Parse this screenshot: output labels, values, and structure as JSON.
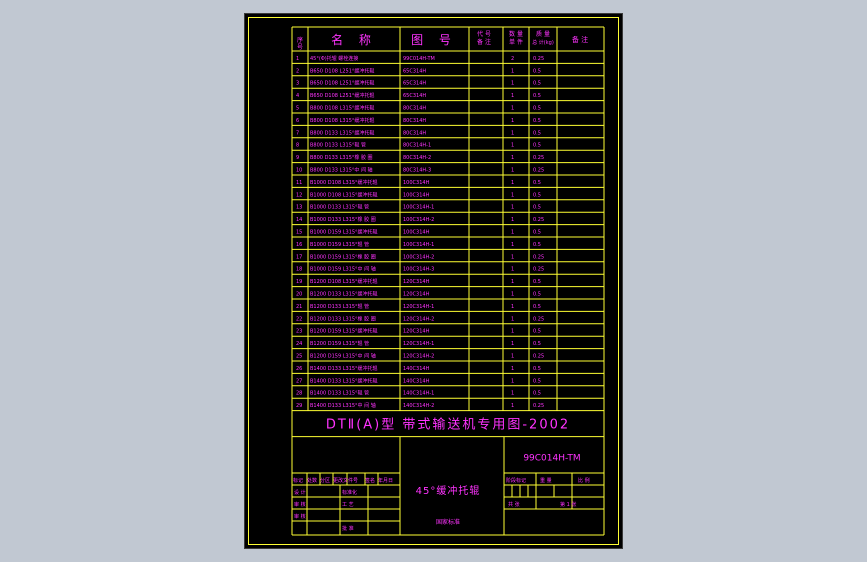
{
  "colors": {
    "background": "#c1c8d2",
    "sheet": "#000000",
    "line": "#ffff33",
    "text": "#ff33ff"
  },
  "header": {
    "seq": "序号",
    "name": "名 称",
    "drawing_no": "图 号",
    "material": "件数",
    "qty": "数量",
    "weight": "质量",
    "remark": "备 注"
  },
  "rows": [
    {
      "seq": "1",
      "name": "45°(Φ)托辊 螺栓连接",
      "dwg": "99C014H-TM",
      "qty": "",
      "mass": "2",
      "w": "0.25"
    },
    {
      "seq": "2",
      "name": "B650 D108 L251°缓冲托辊",
      "dwg": "65C314H",
      "qty": "",
      "mass": "1",
      "w": "0.5"
    },
    {
      "seq": "3",
      "name": "B650 D108 L251°缓冲托辊",
      "dwg": "65C314H",
      "qty": "",
      "mass": "1",
      "w": "0.5"
    },
    {
      "seq": "4",
      "name": "B650 D108 L251°缓冲托辊",
      "dwg": "65C314H",
      "qty": "",
      "mass": "1",
      "w": "0.5"
    },
    {
      "seq": "5",
      "name": "B800 D108 L315°缓冲托辊",
      "dwg": "80C314H",
      "qty": "",
      "mass": "1",
      "w": "0.5"
    },
    {
      "seq": "6",
      "name": "B800 D108 L315°缓冲托辊",
      "dwg": "80C314H",
      "qty": "",
      "mass": "1",
      "w": "0.5"
    },
    {
      "seq": "7",
      "name": "B800 D133 L315°缓冲托辊",
      "dwg": "80C314H",
      "qty": "",
      "mass": "1",
      "w": "0.5"
    },
    {
      "seq": "8",
      "name": "B800 D133 L315°辊 管",
      "dwg": "80C314H-1",
      "qty": "",
      "mass": "1",
      "w": "0.5"
    },
    {
      "seq": "9",
      "name": "B800 D133 L315°橡 胶 圈",
      "dwg": "80C314H-2",
      "qty": "",
      "mass": "1",
      "w": "0.25"
    },
    {
      "seq": "10",
      "name": "B800 D133 L315°中 间 轴",
      "dwg": "80C314H-3",
      "qty": "",
      "mass": "1",
      "w": "0.25"
    },
    {
      "seq": "11",
      "name": "B1000 D108 L315°缓冲托辊",
      "dwg": "100C314H",
      "qty": "",
      "mass": "1",
      "w": "0.5"
    },
    {
      "seq": "12",
      "name": "B1000 D108 L315°缓冲托辊",
      "dwg": "100C314H",
      "qty": "",
      "mass": "1",
      "w": "0.5"
    },
    {
      "seq": "13",
      "name": "B1000 D133 L315°辊 管",
      "dwg": "100C314H-1",
      "qty": "",
      "mass": "1",
      "w": "0.5"
    },
    {
      "seq": "14",
      "name": "B1000 D133 L315°橡 胶 圈",
      "dwg": "100C314H-2",
      "qty": "",
      "mass": "1",
      "w": "0.25"
    },
    {
      "seq": "15",
      "name": "B1000 D159 L315°缓冲托辊",
      "dwg": "100C314H",
      "qty": "",
      "mass": "1",
      "w": "0.5"
    },
    {
      "seq": "16",
      "name": "B1000 D159 L315°辊 管",
      "dwg": "100C314H-1",
      "qty": "",
      "mass": "1",
      "w": "0.5"
    },
    {
      "seq": "17",
      "name": "B1000 D159 L315°橡 胶 圈",
      "dwg": "100C314H-2",
      "qty": "",
      "mass": "1",
      "w": "0.25"
    },
    {
      "seq": "18",
      "name": "B1000 D159 L315°中 间 轴",
      "dwg": "100C314H-3",
      "qty": "",
      "mass": "1",
      "w": "0.25"
    },
    {
      "seq": "19",
      "name": "B1200 D108 L315°缓冲托辊",
      "dwg": "120C314H",
      "qty": "",
      "mass": "1",
      "w": "0.5"
    },
    {
      "seq": "20",
      "name": "B1200 D133 L315°缓冲托辊",
      "dwg": "120C314H",
      "qty": "",
      "mass": "1",
      "w": "0.5"
    },
    {
      "seq": "21",
      "name": "B1200 D133 L315°辊 管",
      "dwg": "120C314H-1",
      "qty": "",
      "mass": "1",
      "w": "0.5"
    },
    {
      "seq": "22",
      "name": "B1200 D133 L315°橡 胶 圈",
      "dwg": "120C314H-2",
      "qty": "",
      "mass": "1",
      "w": "0.25"
    },
    {
      "seq": "23",
      "name": "B1200 D159 L315°缓冲托辊",
      "dwg": "120C314H",
      "qty": "",
      "mass": "1",
      "w": "0.5"
    },
    {
      "seq": "24",
      "name": "B1200 D159 L315°辊 管",
      "dwg": "120C314H-1",
      "qty": "",
      "mass": "1",
      "w": "0.5"
    },
    {
      "seq": "25",
      "name": "B1200 D159 L315°中 间 轴",
      "dwg": "120C314H-2",
      "qty": "",
      "mass": "1",
      "w": "0.25"
    },
    {
      "seq": "26",
      "name": "B1400 D133 L315°缓冲托辊",
      "dwg": "140C314H",
      "qty": "",
      "mass": "1",
      "w": "0.5"
    },
    {
      "seq": "27",
      "name": "B1400 D133 L315°缓冲托辊",
      "dwg": "140C314H",
      "qty": "",
      "mass": "1",
      "w": "0.5"
    },
    {
      "seq": "28",
      "name": "B1400 D133 L315°辊 管",
      "dwg": "140C314H-1",
      "qty": "",
      "mass": "1",
      "w": "0.5"
    },
    {
      "seq": "29",
      "name": "B1400 D133 L315°中 间 轴",
      "dwg": "140C314H-2",
      "qty": "",
      "mass": "1",
      "w": "0.25"
    }
  ],
  "title_block": {
    "main_title": "DTⅡ(A)型 带式输送机专用图-2002",
    "drawing_number": "99C014H-TM",
    "part_name": "45°缓冲托辊",
    "stage_label": "阶段标记",
    "weight_label": "重 量",
    "scale_label": "比 例",
    "sheet_total": "共 张",
    "sheet_no": "第 1 张",
    "rev_header": [
      "标记",
      "处数",
      "分区",
      "更改文件号",
      "签名",
      "年月日"
    ],
    "design": "设 计",
    "standard": "标准化",
    "check": "审 核",
    "process": "工 艺",
    "approve": "批 准",
    "owner": "国家标准"
  }
}
